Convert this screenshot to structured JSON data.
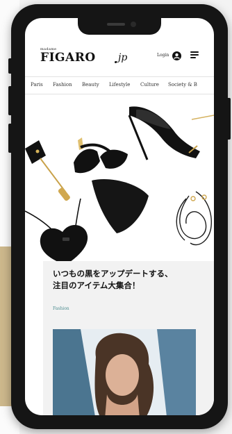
{
  "header": {
    "logo_small": "madame",
    "logo_main": "FIGARO",
    "logo_suffix": "jp",
    "login_label": "Login"
  },
  "nav": {
    "items": [
      "Paris",
      "Fashion",
      "Beauty",
      "Lifestyle",
      "Culture",
      "Society & B"
    ]
  },
  "article": {
    "headline_line1": "いつもの黒をアップデートする、",
    "headline_line2": "注目のアイテム大集合！",
    "category": "Fashion"
  },
  "icons": {
    "user": "user-icon",
    "menu": "hamburger-menu-icon"
  },
  "colors": {
    "tag": "#4b8c8f",
    "accent_gold": "#cdb88c"
  }
}
